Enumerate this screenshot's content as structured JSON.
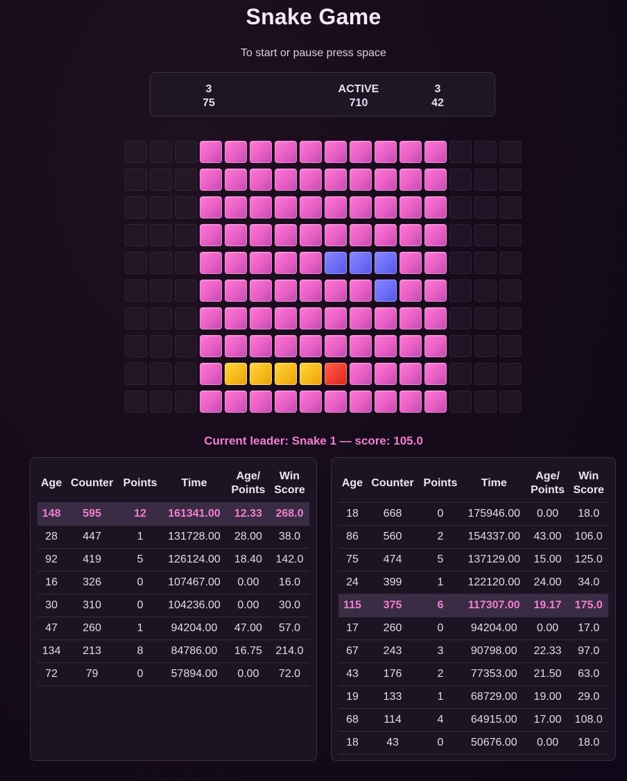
{
  "title": "Snake Game",
  "subtitle": "To start or pause press space",
  "status": {
    "left": {
      "top": "3",
      "bottom": "75"
    },
    "center": {
      "top": "ACTIVE",
      "bottom": "710"
    },
    "right": {
      "top": "3",
      "bottom": "42"
    }
  },
  "board": {
    "cols": 16,
    "rows": 10,
    "colors": {
      "pink": "#e85fc4",
      "blue": "#6a6cf5",
      "yellow": "#f5b718",
      "red": "#ee3b2d",
      "empty": "#2a1f30"
    },
    "grid": [
      "...PPPPPPPPPP...",
      "...PPPPPPPPPP...",
      "...PPPPPPPPPP...",
      "...PPPPPPPPPP...",
      "...PPPPPBBBPP...",
      "...PPPPPPPBPP...",
      "...PPPPPPPPPP...",
      "...PPPPPPPPPP...",
      "...PYYYYRPPPP...",
      "...PPPPPPPPPP..."
    ]
  },
  "leader_text": "Current leader: Snake 1 — score: 105.0",
  "table_headers": [
    "Age",
    "Counter",
    "Points",
    "Time",
    "Age/\nPoints",
    "Win\nScore"
  ],
  "left_table": {
    "highlight_index": 0,
    "rows": [
      [
        "148",
        "595",
        "12",
        "161341.00",
        "12.33",
        "268.0"
      ],
      [
        "28",
        "447",
        "1",
        "131728.00",
        "28.00",
        "38.0"
      ],
      [
        "92",
        "419",
        "5",
        "126124.00",
        "18.40",
        "142.0"
      ],
      [
        "16",
        "326",
        "0",
        "107467.00",
        "0.00",
        "16.0"
      ],
      [
        "30",
        "310",
        "0",
        "104236.00",
        "0.00",
        "30.0"
      ],
      [
        "47",
        "260",
        "1",
        "94204.00",
        "47.00",
        "57.0"
      ],
      [
        "134",
        "213",
        "8",
        "84786.00",
        "16.75",
        "214.0"
      ],
      [
        "72",
        "79",
        "0",
        "57894.00",
        "0.00",
        "72.0"
      ]
    ]
  },
  "right_table": {
    "highlight_index": 4,
    "rows": [
      [
        "18",
        "668",
        "0",
        "175946.00",
        "0.00",
        "18.0"
      ],
      [
        "86",
        "560",
        "2",
        "154337.00",
        "43.00",
        "106.0"
      ],
      [
        "75",
        "474",
        "5",
        "137129.00",
        "15.00",
        "125.0"
      ],
      [
        "24",
        "399",
        "1",
        "122120.00",
        "24.00",
        "34.0"
      ],
      [
        "115",
        "375",
        "6",
        "117307.00",
        "19.17",
        "175.0"
      ],
      [
        "17",
        "260",
        "0",
        "94204.00",
        "0.00",
        "17.0"
      ],
      [
        "67",
        "243",
        "3",
        "90798.00",
        "22.33",
        "97.0"
      ],
      [
        "43",
        "176",
        "2",
        "77353.00",
        "21.50",
        "63.0"
      ],
      [
        "19",
        "133",
        "1",
        "68729.00",
        "19.00",
        "29.0"
      ],
      [
        "68",
        "114",
        "4",
        "64915.00",
        "17.00",
        "108.0"
      ],
      [
        "18",
        "43",
        "0",
        "50676.00",
        "0.00",
        "18.0"
      ]
    ]
  }
}
